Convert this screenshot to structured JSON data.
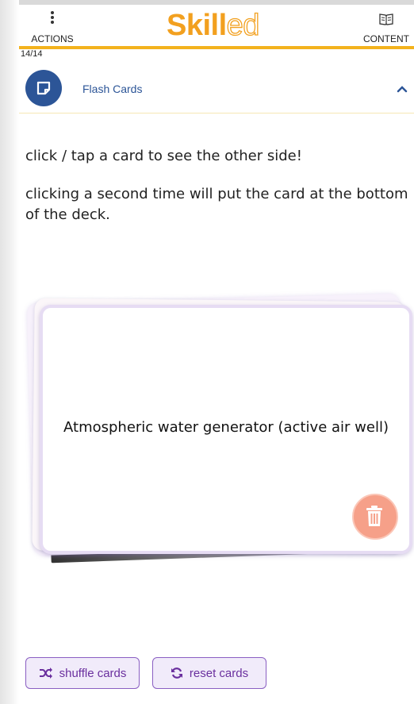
{
  "header": {
    "actions_label": "ACTIONS",
    "content_label": "CONTENT",
    "logo_part1": "Skill",
    "logo_part2": "ed",
    "counter": "14/14"
  },
  "section": {
    "title": "Flash Cards"
  },
  "instructions": {
    "line1": "click / tap a card to see the other side!",
    "line2": "clicking a second time will put the card at the bottom of the deck."
  },
  "card": {
    "text": "Atmospheric water generator (active air well)"
  },
  "buttons": {
    "shuffle": "shuffle cards",
    "reset": "reset cards"
  },
  "colors": {
    "accent": "#f3b21c",
    "brand_blue": "#2c5597",
    "button_purple": "#6a2f9e",
    "trash": "#f6a089"
  },
  "icons": [
    "kebab-icon",
    "book-icon",
    "note-icon",
    "chevron-up-icon",
    "trash-icon",
    "shuffle-icon",
    "refresh-icon"
  ]
}
